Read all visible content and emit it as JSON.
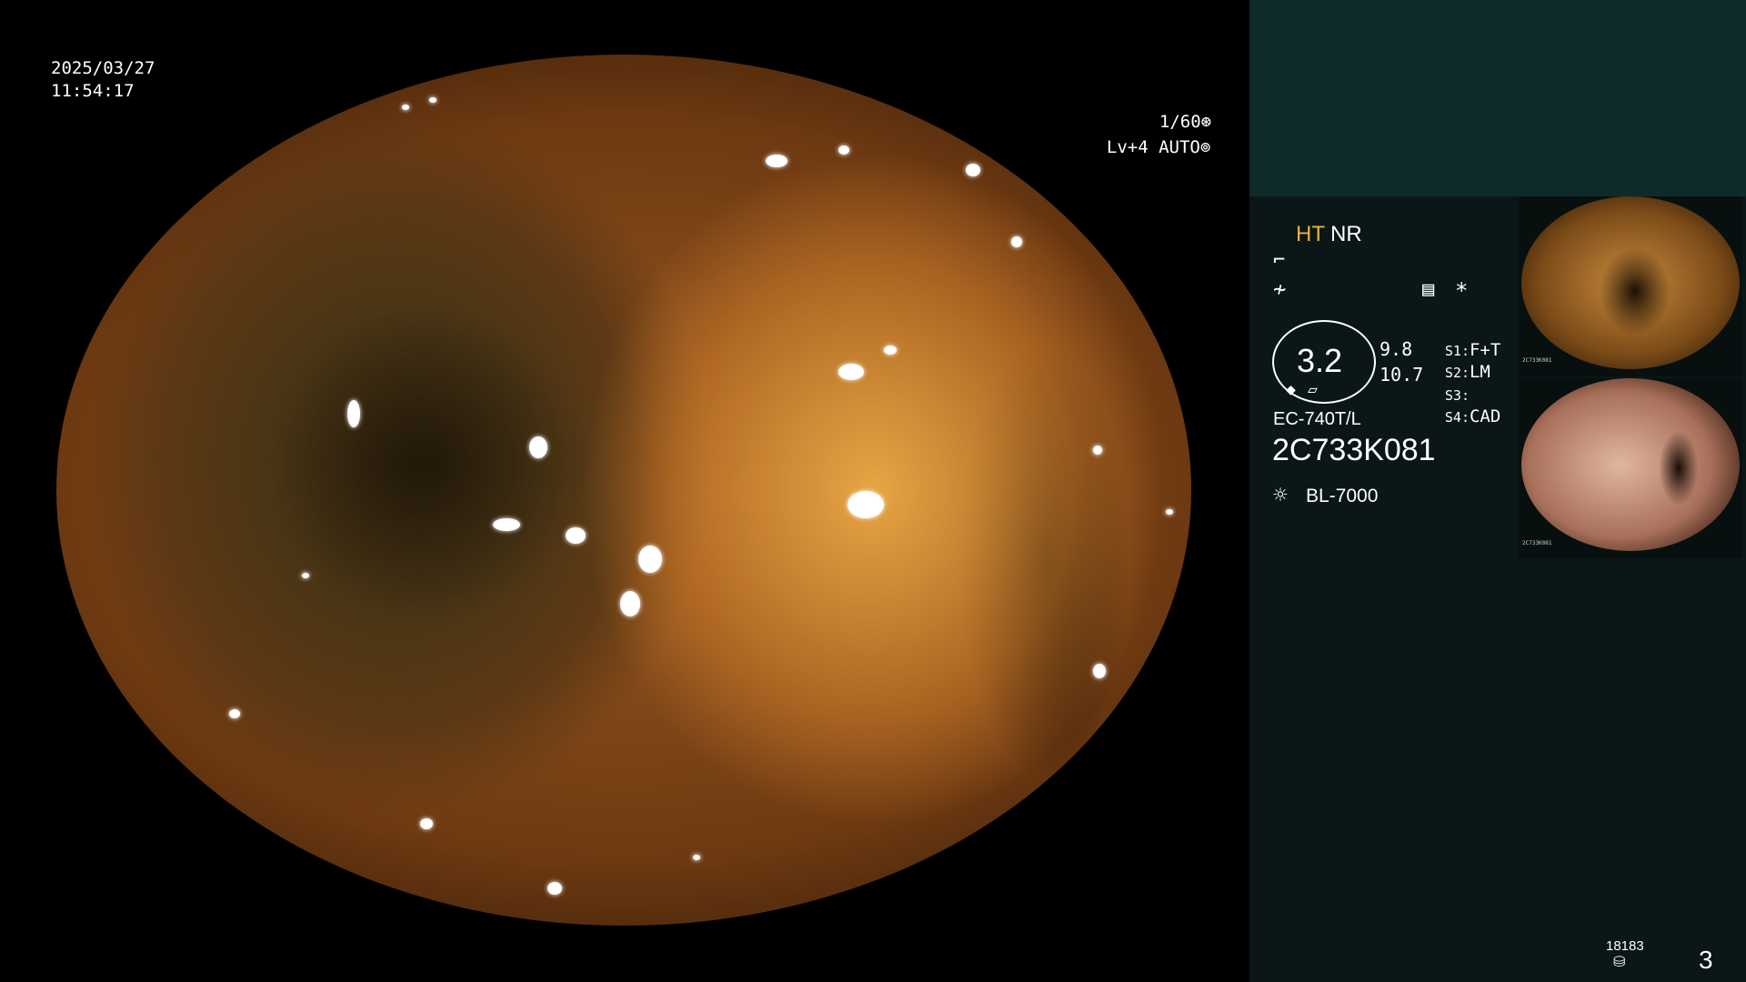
{
  "overlay": {
    "date": "2025/03/27",
    "time": "11:54:17",
    "shutter": "1/60",
    "level": "Lv+4",
    "mode": "AUTO"
  },
  "panel": {
    "ht": "HT",
    "nr": "NR",
    "gauge_value": "3.2",
    "values": [
      "9.8",
      "10.7"
    ],
    "settings": [
      {
        "key": "S1:",
        "value": "F+T"
      },
      {
        "key": "S2:",
        "value": "LM"
      },
      {
        "key": "S3:",
        "value": ""
      },
      {
        "key": "S4:",
        "value": "CAD"
      }
    ],
    "scope_model": "EC-740T/L",
    "serial": "2C733K081",
    "light_source": "BL-7000",
    "counter": "18183",
    "page": "3",
    "thumbnails": [
      {
        "serial": "2C733K081"
      },
      {
        "serial": "2C733K081"
      }
    ]
  },
  "colors": {
    "accent_ht": "#f0b040",
    "panel_bg": "#0a1617",
    "panel_top": "#0f2a2a"
  }
}
